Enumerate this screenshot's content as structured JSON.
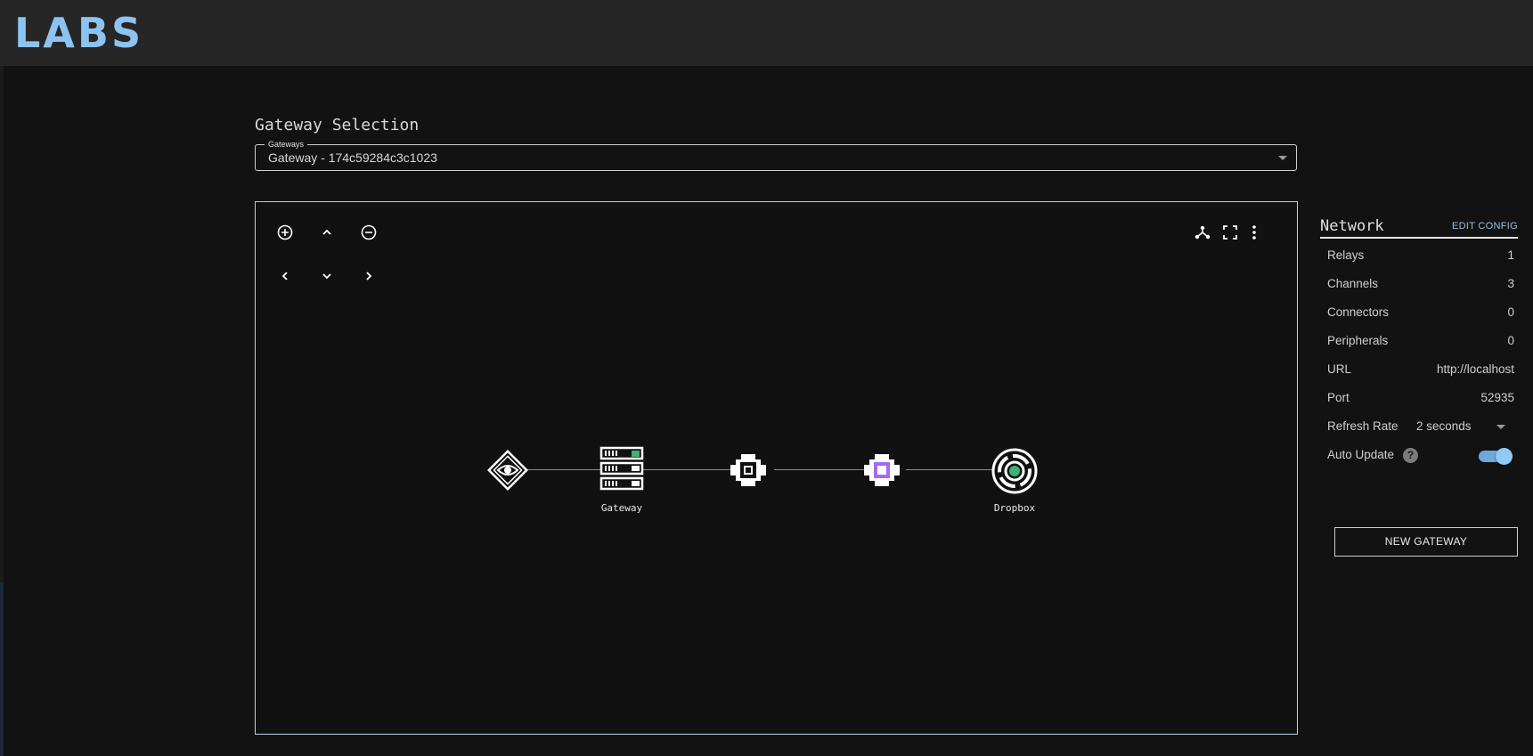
{
  "app": {
    "logo_text": "LABS"
  },
  "gateway_selection": {
    "title": "Gateway Selection",
    "legend": "Gateways",
    "selected": "Gateway - 174c59284c3c1023"
  },
  "graph": {
    "controls": [
      "zoom-in-icon",
      "pan-up-icon",
      "zoom-out-icon",
      "pan-left-icon",
      "pan-down-icon",
      "pan-right-icon"
    ],
    "toolbar": [
      "hierarchy-icon",
      "fullscreen-icon",
      "more-vert-icon"
    ],
    "nodes": [
      {
        "name": "eye-node",
        "label": ""
      },
      {
        "name": "gateway-node",
        "label": "Gateway"
      },
      {
        "name": "channel-node",
        "label": ""
      },
      {
        "name": "channel-purple-node",
        "label": ""
      },
      {
        "name": "dropbox-node",
        "label": "Dropbox"
      }
    ],
    "colors": {
      "status_green": "#3cb371",
      "accent_purple": "#a66bf0",
      "border": "#b8cfe6"
    }
  },
  "network": {
    "title": "Network",
    "edit_label": "EDIT CONFIG",
    "stats": [
      {
        "label": "Relays",
        "value": "1"
      },
      {
        "label": "Channels",
        "value": "3"
      },
      {
        "label": "Connectors",
        "value": "0"
      },
      {
        "label": "Peripherals",
        "value": "0"
      },
      {
        "label": "URL",
        "value": "http://localhost"
      },
      {
        "label": "Port",
        "value": "52935"
      }
    ],
    "refresh_label": "Refresh Rate",
    "refresh_value": "2 seconds",
    "auto_update_label": "Auto Update",
    "auto_update_on": true,
    "help_glyph": "?",
    "new_gateway_label": "NEW GATEWAY"
  }
}
